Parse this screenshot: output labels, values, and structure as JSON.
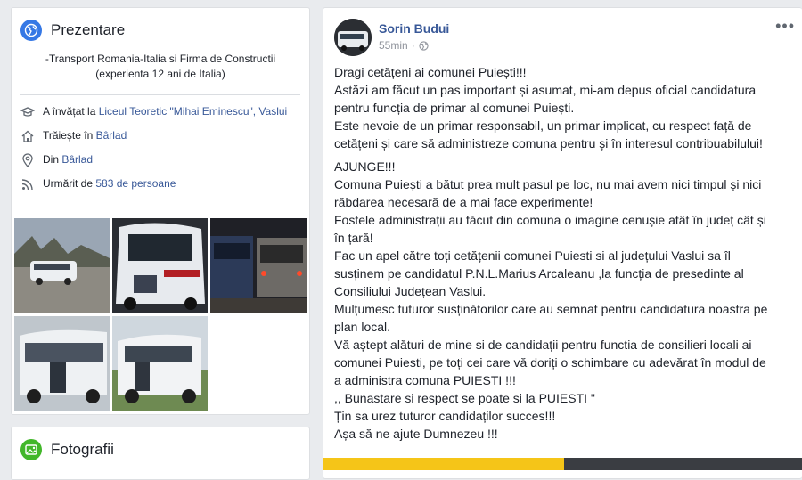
{
  "intro": {
    "title": "Prezentare",
    "bio_line1": "-Transport Romania-Italia si Firma de Constructii",
    "bio_line2": "(experienta 12 ani de Italia)",
    "studied_prefix": "A învățat la ",
    "studied_link": "Liceul Teoretic \"Mihai Eminescu\", Vaslui",
    "lives_prefix": "Trăiește în ",
    "lives_link": "Bârlad",
    "from_prefix": "Din ",
    "from_link": "Bârlad",
    "followed_prefix": "Urmărit de ",
    "followed_link": "583 de persoane",
    "icons": {
      "globe": "globe-icon",
      "education": "graduation-cap-icon",
      "home": "home-icon",
      "location": "location-pin-icon",
      "followers": "rss-icon"
    },
    "accent": "#3578e5"
  },
  "photos_card": {
    "title": "Fotografii",
    "icon": "photo-icon",
    "accent": "#42b72a"
  },
  "post": {
    "author": "Sorin Budui",
    "time": "55min",
    "privacy_icon": "globe-icon",
    "more_label": "•••",
    "paragraph1": [
      "Dragi cetățeni ai comunei Puiești!!!",
      "Astăzi am făcut un pas important și asumat, mi-am depus oficial candidatura",
      "pentru funcția de primar al comunei Puiești.",
      "Este nevoie de un primar responsabil, un primar implicat, cu respect față de",
      "cetățeni și care să administreze comuna pentru și în interesul contribuabilului!"
    ],
    "paragraph2": [
      "AJUNGE!!!",
      "Comuna Puiești a bătut prea mult pasul pe loc, nu mai avem nici timpul și nici",
      "răbdarea necesară de a mai face experimente!",
      "Fostele administrații au făcut din comuna o imagine cenușie atât în județ cât și",
      "în țară!",
      "Fac un apel către toți cetățenii comunei Puiesti si al județului Vaslui sa îl",
      "susținem pe candidatul P.N.L.Marius Arcaleanu ,la funcția de presedinte al",
      "Consiliului Județean Vaslui.",
      "Mulțumesc tuturor susținătorilor care au semnat pentru candidatura noastra pe",
      "plan local.",
      "Vă aștept alături de mine si de candidații pentru functia de consilieri locali ai",
      "comunei Puiesti, pe toți cei care vă doriți o schimbare cu adevărat în modul de",
      "a administra comuna PUIESTI !!!",
      ",, Bunastare si respect se poate si la PUIESTI \"",
      "Țin sa urez tuturor candidaților succes!!!",
      "Așa să ne ajute Dumnezeu !!!"
    ]
  }
}
